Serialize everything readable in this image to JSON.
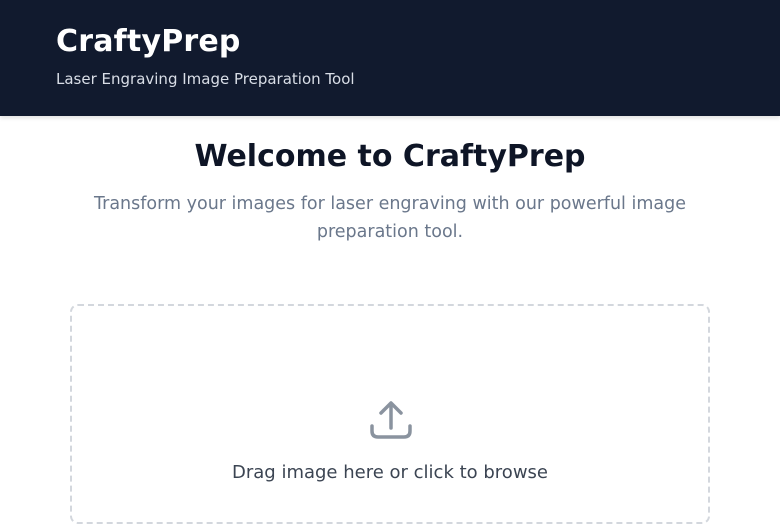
{
  "header": {
    "title": "CraftyPrep",
    "subtitle": "Laser Engraving Image Preparation Tool"
  },
  "main": {
    "welcome_title": "Welcome to CraftyPrep",
    "welcome_description": "Transform your images for laser engraving with our powerful image preparation tool."
  },
  "dropzone": {
    "icon": "upload-icon",
    "label": "Drag image here or click to browse"
  },
  "colors": {
    "header_bg": "#111a2e",
    "title_text": "#0e1526",
    "muted_text": "#6a778b",
    "dropzone_border": "#d3d7dd",
    "icon": "#8a939f"
  }
}
